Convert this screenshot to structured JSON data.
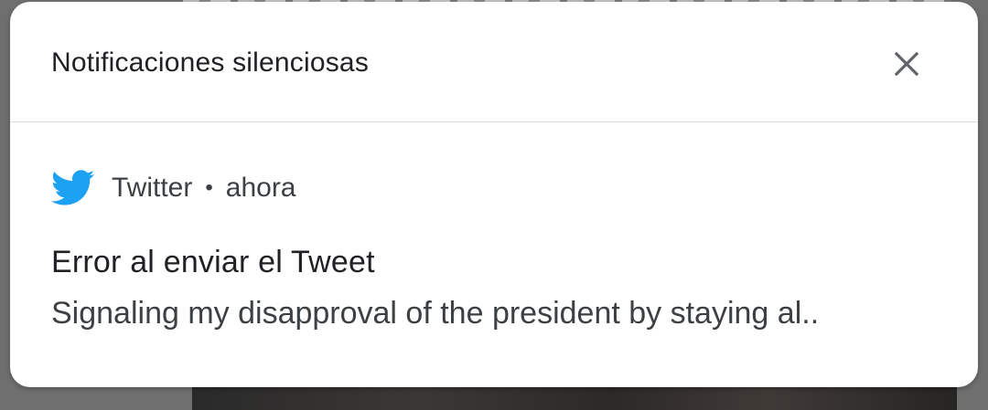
{
  "panel": {
    "title": "Notificaciones silenciosas",
    "close_icon": "close-icon"
  },
  "notification": {
    "app_icon": "twitter-bird-icon",
    "app_name": "Twitter",
    "separator": "•",
    "time": "ahora",
    "title": "Error al enviar el Tweet",
    "body": "Signaling my disapproval of the president by staying al.."
  },
  "colors": {
    "twitter_blue": "#1da1f2",
    "text_primary": "#202124",
    "text_secondary": "#3c4043",
    "icon_gray": "#5f6368"
  }
}
